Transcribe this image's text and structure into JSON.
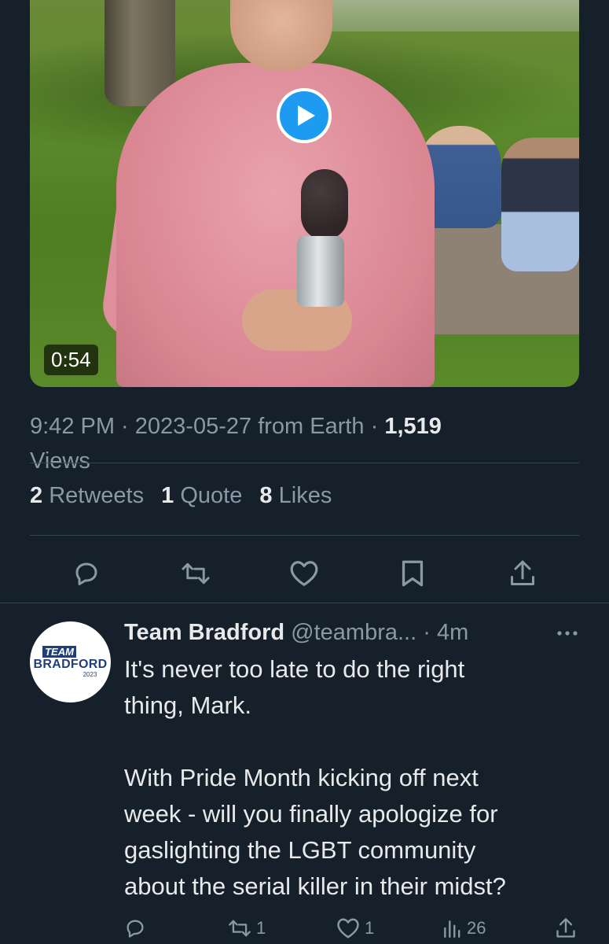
{
  "video": {
    "duration": "0:54"
  },
  "tweet_meta": {
    "time": "9:42 PM",
    "date": "2023-05-27",
    "source": "from Earth",
    "views_count": "1,519",
    "views_label": "Views"
  },
  "engagement": {
    "retweets_count": "2",
    "retweets_label": "Retweets",
    "quotes_count": "1",
    "quotes_label": "Quote",
    "likes_count": "8",
    "likes_label": "Likes"
  },
  "reply": {
    "avatar": {
      "line1": "TEAM",
      "line2": "BRADFORD",
      "line3": "2023"
    },
    "display_name": "Team Bradford",
    "handle": "@teambra...",
    "time": "4m",
    "text": "It's never too late to do the right\nthing, Mark.\n\nWith Pride Month kicking off next\nweek - will you finally apologize for\ngaslighting the LGBT community\nabout the serial killer in their midst?",
    "retweet_count": "1",
    "like_count": "1",
    "view_count": "26"
  },
  "colors": {
    "background": "#15202b",
    "accent": "#1d9bf0",
    "muted": "#8b98a5",
    "text": "#e7e9ea"
  }
}
